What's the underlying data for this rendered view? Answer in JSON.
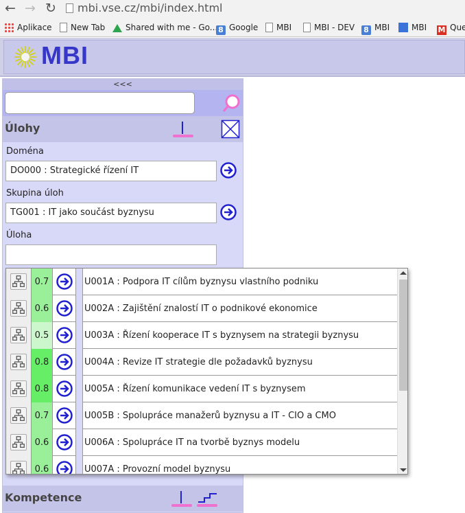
{
  "browser": {
    "url": "mbi.vse.cz/mbi/index.html",
    "bookmarks": [
      {
        "label": "Aplikace",
        "icon": "apps-icon"
      },
      {
        "label": "New Tab",
        "icon": "page-icon"
      },
      {
        "label": "Shared with me - Go...",
        "icon": "drive-icon"
      },
      {
        "label": "Google",
        "icon": "google-icon"
      },
      {
        "label": "MBI",
        "icon": "page-icon"
      },
      {
        "label": "MBI - DEV",
        "icon": "page-icon"
      },
      {
        "label": "MBI",
        "icon": "google-icon"
      },
      {
        "label": "MBI",
        "icon": "docs-icon"
      },
      {
        "label": "Que",
        "icon": "gmail-icon"
      }
    ]
  },
  "app": {
    "logo_text": "MBI",
    "collapse_label": "<<<",
    "search_value": ""
  },
  "tasks": {
    "title": "Úlohy",
    "domain_label": "Doména",
    "domain_value": "DO000 : Strategické řízení IT",
    "group_label": "Skupina úloh",
    "group_value": "TG001 : IT jako součást byznysu",
    "task_label": "Úloha",
    "task_value": ""
  },
  "competence": {
    "title": "Kompetence"
  },
  "dropdown": {
    "items": [
      {
        "score": "0.7",
        "text": "U001A : Podpora IT cílům byznysu vlastního podniku"
      },
      {
        "score": "0.6",
        "text": "U002A : Zajištění znalostí IT o podnikové ekonomice"
      },
      {
        "score": "0.5",
        "text": "U003A : Řízení kooperace IT s byznysem na strategii byznysu"
      },
      {
        "score": "0.8",
        "text": "U004A : Revize IT strategie dle požadavků byznysu"
      },
      {
        "score": "0.8",
        "text": "U005A : Řízení komunikace vedení IT s byznysem"
      },
      {
        "score": "0.7",
        "text": "U005B : Spolupráce manažerů byznysu a IT - CIO a CMO"
      },
      {
        "score": "0.6",
        "text": "U006A : Spolupráce IT na tvorbě byznys modelu"
      },
      {
        "score": "0.6",
        "text": "U007A : Provozní model byznysu"
      }
    ]
  },
  "colors": {
    "accent": "#3636c8",
    "panel": "#d8d8f8",
    "score_high": "#66ee66",
    "score_mid": "#99f099",
    "score_low": "#ccf7cc",
    "arrow": "#2020d0",
    "icon_magenta": "#f070d0"
  }
}
